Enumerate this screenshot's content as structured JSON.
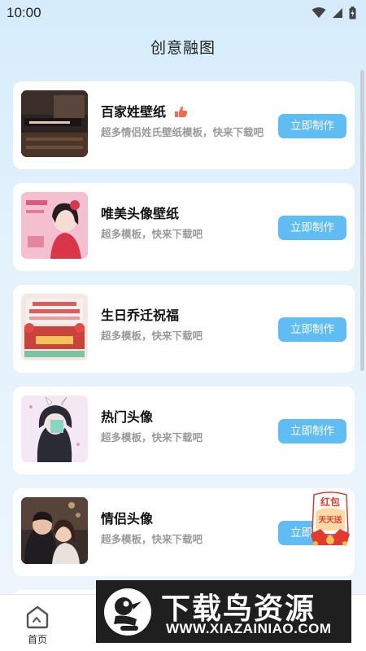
{
  "status_bar": {
    "time": "10:00"
  },
  "header": {
    "title": "创意融图"
  },
  "cards": [
    {
      "title": "百家姓壁纸",
      "description": "超多情侣姓氏壁纸模板，快来下载吧",
      "button_label": "立即制作",
      "hot": true
    },
    {
      "title": "唯美头像壁纸",
      "description": "超多模板，快来下载吧",
      "button_label": "立即制作",
      "hot": false
    },
    {
      "title": "生日乔迁祝福",
      "description": "超多模板，快来下载吧",
      "button_label": "立即制作",
      "hot": false
    },
    {
      "title": "热门头像",
      "description": "超多模板，快来下载吧",
      "button_label": "立即制作",
      "hot": false
    },
    {
      "title": "情侣头像",
      "description": "超多模板，快来下载吧",
      "button_label": "立即制作",
      "hot": false
    }
  ],
  "bottom_nav": {
    "home_label": "首页"
  },
  "floating_badge": {
    "line1": "红包",
    "line2": "天天送"
  },
  "watermark": {
    "name": "下载鸟资源",
    "url": "WWW.XIAZAINIAO.COM"
  },
  "colors": {
    "accent": "#5fbdf3",
    "background": "#d6ecfb",
    "card": "#ffffff"
  }
}
